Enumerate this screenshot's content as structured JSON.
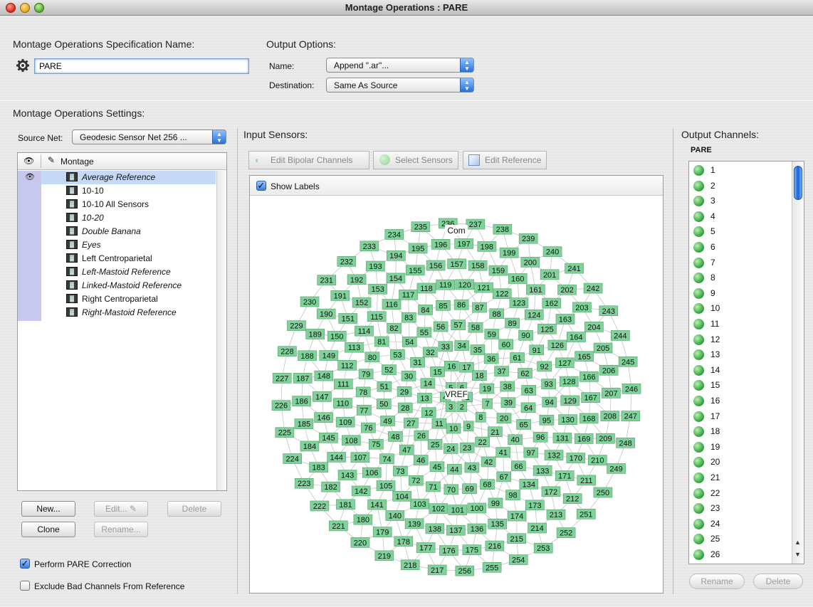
{
  "window": {
    "title": "Montage Operations : PARE"
  },
  "spec": {
    "label": "Montage Operations Specification Name:",
    "value": "PARE"
  },
  "output_options": {
    "label": "Output Options:",
    "name_label": "Name:",
    "name_value": "Append \".ar\"...",
    "destination_label": "Destination:",
    "destination_value": "Same As Source"
  },
  "settings": {
    "label": "Montage Operations Settings:"
  },
  "source_net": {
    "label": "Source Net:",
    "value": "Geodesic Sensor Net 256 ..."
  },
  "montage_list": {
    "header": "Montage",
    "items": [
      {
        "label": "Average Reference",
        "italic": true,
        "selected": true
      },
      {
        "label": "10-10",
        "italic": false
      },
      {
        "label": "10-10 All Sensors",
        "italic": false
      },
      {
        "label": "10-20",
        "italic": true
      },
      {
        "label": "Double Banana",
        "italic": true
      },
      {
        "label": "Eyes",
        "italic": true
      },
      {
        "label": "Left Centroparietal",
        "italic": false
      },
      {
        "label": "Left-Mastoid Reference",
        "italic": true
      },
      {
        "label": "Linked-Mastoid Reference",
        "italic": true
      },
      {
        "label": "Right Centroparietal",
        "italic": false
      },
      {
        "label": "Right-Mastoid Reference",
        "italic": true
      }
    ]
  },
  "buttons": {
    "new": "New...",
    "edit": "Edit...",
    "delete": "Delete",
    "clone": "Clone",
    "rename": "Rename..."
  },
  "options": {
    "pare_correction": "Perform PARE Correction",
    "exclude_bad": "Exclude Bad Channels From Reference"
  },
  "input_sensors": {
    "label": "Input Sensors:",
    "edit_bipolar": "Edit Bipolar Channels",
    "select_sensors": "Select Sensors",
    "edit_reference": "Edit Reference",
    "show_labels": "Show Labels",
    "com_label": "Com",
    "vref_label": "VREF",
    "sensor_color": "#7fd39a"
  },
  "output_channels": {
    "label": "Output Channels:",
    "list_name": "PARE",
    "channels": [
      "1",
      "2",
      "3",
      "4",
      "5",
      "6",
      "7",
      "8",
      "9",
      "10",
      "11",
      "12",
      "13",
      "14",
      "15",
      "16",
      "17",
      "18",
      "19",
      "20",
      "21",
      "22",
      "23",
      "24",
      "25",
      "26"
    ],
    "rename": "Rename",
    "delete": "Delete"
  }
}
